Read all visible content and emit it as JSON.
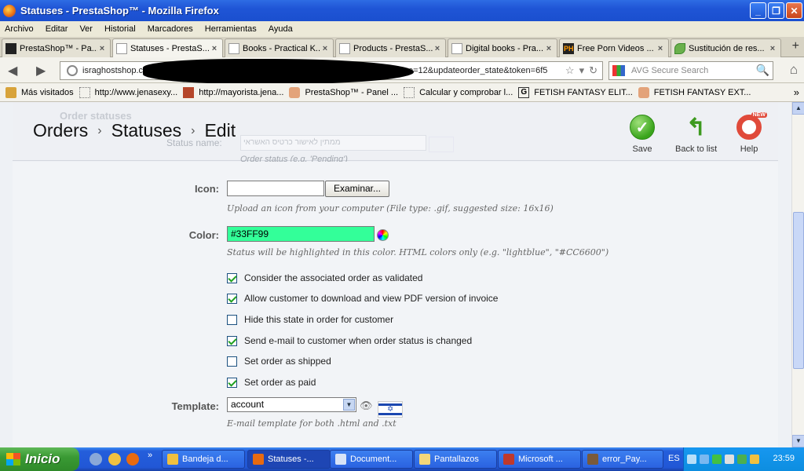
{
  "window": {
    "title": "Statuses - PrestaShop™ - Mozilla Firefox",
    "buttons": [
      "_",
      "❐",
      "✕"
    ]
  },
  "menu": [
    "Archivo",
    "Editar",
    "Ver",
    "Historial",
    "Marcadores",
    "Herramientas",
    "Ayuda"
  ],
  "tabs": [
    {
      "label": "PrestaShop™ - Pa...",
      "icon": "ps"
    },
    {
      "label": "Statuses - PrestaS...",
      "icon": "ps",
      "active": true
    },
    {
      "label": "Books - Practical K...",
      "icon": "blank"
    },
    {
      "label": "Products - PrestaS...",
      "icon": "ps"
    },
    {
      "label": "Digital books - Pra...",
      "icon": "blank"
    },
    {
      "label": "Free Porn Videos ...",
      "icon": "ph"
    },
    {
      "label": "Sustitución de res...",
      "icon": "leaf"
    }
  ],
  "nav": {
    "url_left": "israghostshop.co",
    "url_right": "e=12&updateorder_state&token=6f5",
    "search_placeholder": "AVG Secure Search"
  },
  "bookmarks": [
    {
      "label": "Más visitados",
      "icon": "folder"
    },
    {
      "label": "http://www.jenasexy...",
      "icon": "blank"
    },
    {
      "label": "http://mayorista.jena...",
      "icon": "img"
    },
    {
      "label": "PrestaShop™ - Panel ...",
      "icon": "face"
    },
    {
      "label": "Calcular y comprobar l...",
      "icon": "blank"
    },
    {
      "label": "FETISH FANTASY ELIT...",
      "icon": "g"
    },
    {
      "label": "FETISH FANTASY EXT...",
      "icon": "face"
    }
  ],
  "page": {
    "ghost_title": "Order statuses",
    "ghost_label": "Status name:",
    "ghost_field": "ממתין לאישור כרטיס האשראי",
    "ghost_hint": "Order status (e.g. 'Pending')",
    "breadcrumb": [
      "Orders",
      "Statuses",
      "Edit"
    ],
    "toolbar": {
      "save": "Save",
      "back": "Back to list",
      "help": "Help",
      "new_badge": "NEW"
    },
    "icon_label": "Icon:",
    "browse_label": "Examinar...",
    "icon_hint": "Upload an icon from your computer (File type: .gif, suggested size: 16x16)",
    "color_label": "Color:",
    "color_value": "#33FF99",
    "color_hint": "Status will be highlighted in this color. HTML colors only (e.g. \"lightblue\", \"#CC6600\")",
    "checkboxes": [
      {
        "label": "Consider the associated order as validated",
        "checked": true
      },
      {
        "label": "Allow customer to download and view PDF version of invoice",
        "checked": true
      },
      {
        "label": "Hide this state in order for customer",
        "checked": false
      },
      {
        "label": "Send e-mail to customer when order status is changed",
        "checked": true
      },
      {
        "label": "Set order as shipped",
        "checked": false
      },
      {
        "label": "Set order as paid",
        "checked": true
      }
    ],
    "template_label": "Template:",
    "template_value": "account",
    "template_hint": "E-mail template for both .html and .txt"
  },
  "taskbar": {
    "start": "Inicio",
    "tasks": [
      {
        "label": "Bandeja d...",
        "active": false
      },
      {
        "label": "Statuses -...",
        "active": true
      },
      {
        "label": "Document...",
        "active": false
      },
      {
        "label": "Pantallazos",
        "active": false
      },
      {
        "label": "Microsoft ...",
        "active": false
      },
      {
        "label": "error_Pay...",
        "active": false
      }
    ],
    "lang": "ES",
    "clock": "23:59"
  },
  "colors": {
    "color_field": "#33FF99",
    "titlebar": "#1f55d6",
    "check": "#21a121"
  }
}
